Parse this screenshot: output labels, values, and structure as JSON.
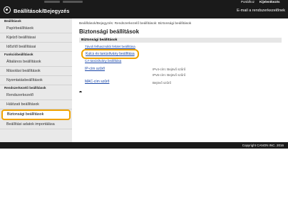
{
  "header": {
    "top_links": [
      "Portálhoz",
      "Kijelentkezés"
    ],
    "title": "Beállítások/Bejegyzés",
    "email": "E-mail a rendszerkezelőnek"
  },
  "sidebar": {
    "sections": [
      {
        "label": "Beállítások",
        "items": [
          "Papírbeállítások",
          "Kijelző beállításai",
          "Időzítő beállításai"
        ]
      },
      {
        "label": "Funkcióbeállítások",
        "items": [
          "Általános beállítások",
          "Másolási beállítások",
          "Nyomtatásbeállítások"
        ]
      },
      {
        "label": "Rendszerkezelő beállítások",
        "items": [
          "Rendszerkezelő",
          "Hálózati beállítások",
          "Biztonsági beállítások",
          "Beállítási adatok importálása"
        ]
      }
    ],
    "active": "Biztonsági beállítások"
  },
  "main": {
    "breadcrumb": "Beállítások/Bejegyzés: Rendszerkezelő beállítások: Biztonsági beállítások",
    "title": "Biztonsági beállítások",
    "section_header": "Biztonsági beállítások",
    "links": {
      "lock": "Távoli felhasználói felület beállítása",
      "key": "Kulcs és tanúsítvány beállítása",
      "ca": "CA-tanúsítvány beállítása",
      "ip": "IP-cím szűrő",
      "mac": "MAC-cím szűrő"
    },
    "statuses": {
      "ipv4": "IPv4-cím: Bejövő szűrő",
      "ipv6": "IPv6-cím: Bejövő szűrő",
      "mac": "Bejövő szűrő"
    },
    "top_mark": "⯊"
  },
  "footer": {
    "copyright": "Copyright CANON INC. 2016"
  }
}
